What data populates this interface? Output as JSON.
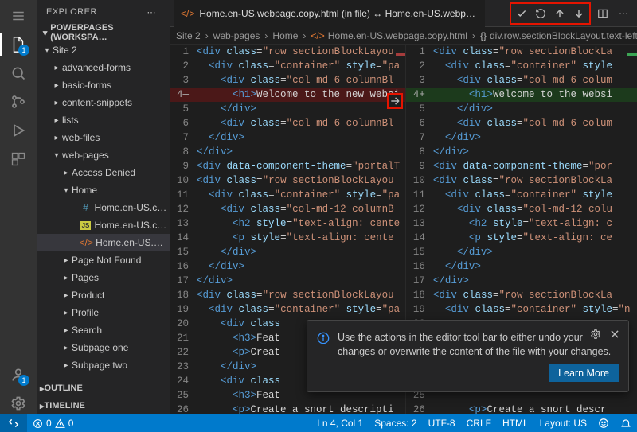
{
  "explorer": {
    "title": "EXPLORER",
    "workspace": "POWERPAGES (WORKSPA…",
    "outline": "OUTLINE",
    "timeline": "TIMELINE",
    "tree": [
      {
        "label": "Site 2",
        "depth": 0,
        "expanded": true,
        "type": "folder"
      },
      {
        "label": "advanced-forms",
        "depth": 1,
        "expanded": false,
        "type": "folder"
      },
      {
        "label": "basic-forms",
        "depth": 1,
        "expanded": false,
        "type": "folder"
      },
      {
        "label": "content-snippets",
        "depth": 1,
        "expanded": false,
        "type": "folder"
      },
      {
        "label": "lists",
        "depth": 1,
        "expanded": false,
        "type": "folder"
      },
      {
        "label": "web-files",
        "depth": 1,
        "expanded": false,
        "type": "folder"
      },
      {
        "label": "web-pages",
        "depth": 1,
        "expanded": true,
        "type": "folder"
      },
      {
        "label": "Access Denied",
        "depth": 2,
        "expanded": false,
        "type": "folder"
      },
      {
        "label": "Home",
        "depth": 2,
        "expanded": true,
        "type": "folder"
      },
      {
        "label": "Home.en-US.cust…",
        "depth": 3,
        "type": "file",
        "icon": "hash"
      },
      {
        "label": "Home.en-US.cust…",
        "depth": 3,
        "type": "file",
        "icon": "js"
      },
      {
        "label": "Home.en-US.web…",
        "depth": 3,
        "type": "file",
        "icon": "code",
        "selected": true
      },
      {
        "label": "Page Not Found",
        "depth": 2,
        "expanded": false,
        "type": "folder"
      },
      {
        "label": "Pages",
        "depth": 2,
        "expanded": false,
        "type": "folder"
      },
      {
        "label": "Product",
        "depth": 2,
        "expanded": false,
        "type": "folder"
      },
      {
        "label": "Profile",
        "depth": 2,
        "expanded": false,
        "type": "folder"
      },
      {
        "label": "Search",
        "depth": 2,
        "expanded": false,
        "type": "folder"
      },
      {
        "label": "Subpage one",
        "depth": 2,
        "expanded": false,
        "type": "folder"
      },
      {
        "label": "Subpage two",
        "depth": 2,
        "expanded": false,
        "type": "folder"
      },
      {
        "label": "web-templates",
        "depth": 1,
        "expanded": false,
        "type": "folder"
      }
    ]
  },
  "tab": {
    "label": "Home.en-US.webpage.copy.html (in file) ↔ Home.en-US.webpage.copy"
  },
  "breadcrumbs": [
    {
      "label": "Site 2"
    },
    {
      "label": "web-pages"
    },
    {
      "label": "Home"
    },
    {
      "label": "Home.en-US.webpage.copy.html",
      "icon": "code"
    },
    {
      "label": "div.row.sectionBlockLayout.text-left",
      "icon": "brackets"
    }
  ],
  "diff": {
    "left": [
      {
        "n": 1,
        "html": "<span class='tok-tag'>&lt;div</span> <span class='tok-attr'>class</span>=<span class='tok-str'>\"row sectionBlockLayou</span>"
      },
      {
        "n": 2,
        "html": "  <span class='tok-tag'>&lt;div</span> <span class='tok-attr'>class</span>=<span class='tok-str'>\"container\"</span> <span class='tok-attr'>style</span>=<span class='tok-str'>\"pa</span>"
      },
      {
        "n": 3,
        "html": "    <span class='tok-tag'>&lt;div</span> <span class='tok-attr'>class</span>=<span class='tok-str'>\"col-md-6 columnBl</span>"
      },
      {
        "n": "4—",
        "html": "      <span class='tok-tag'>&lt;h1&gt;</span><span class='tok-txt'>Welcome to the new websi</span>",
        "cls": "diff-del"
      },
      {
        "n": 5,
        "html": "    <span class='tok-tag'>&lt;/div&gt;</span>"
      },
      {
        "n": 6,
        "html": "    <span class='tok-tag'>&lt;div</span> <span class='tok-attr'>class</span>=<span class='tok-str'>\"col-md-6 columnBl</span>"
      },
      {
        "n": 7,
        "html": "  <span class='tok-tag'>&lt;/div&gt;</span>"
      },
      {
        "n": 8,
        "html": "<span class='tok-tag'>&lt;/div&gt;</span>"
      },
      {
        "n": 9,
        "html": "<span class='tok-tag'>&lt;div</span> <span class='tok-attr'>data-component-theme</span>=<span class='tok-str'>\"portalT</span>"
      },
      {
        "n": 10,
        "html": "<span class='tok-tag'>&lt;div</span> <span class='tok-attr'>class</span>=<span class='tok-str'>\"row sectionBlockLayou</span>"
      },
      {
        "n": 11,
        "html": "  <span class='tok-tag'>&lt;div</span> <span class='tok-attr'>class</span>=<span class='tok-str'>\"container\"</span> <span class='tok-attr'>style</span>=<span class='tok-str'>\"pa</span>"
      },
      {
        "n": 12,
        "html": "    <span class='tok-tag'>&lt;div</span> <span class='tok-attr'>class</span>=<span class='tok-str'>\"col-md-12 columnB</span>"
      },
      {
        "n": 13,
        "html": "      <span class='tok-tag'>&lt;h2</span> <span class='tok-attr'>style</span>=<span class='tok-str'>\"text-align: cente</span>"
      },
      {
        "n": 14,
        "html": "      <span class='tok-tag'>&lt;p</span> <span class='tok-attr'>style</span>=<span class='tok-str'>\"text-align: cente</span>"
      },
      {
        "n": 15,
        "html": "    <span class='tok-tag'>&lt;/div&gt;</span>"
      },
      {
        "n": 16,
        "html": "  <span class='tok-tag'>&lt;/div&gt;</span>"
      },
      {
        "n": 17,
        "html": "<span class='tok-tag'>&lt;/div&gt;</span>"
      },
      {
        "n": 18,
        "html": "<span class='tok-tag'>&lt;div</span> <span class='tok-attr'>class</span>=<span class='tok-str'>\"row sectionBlockLayou</span>"
      },
      {
        "n": 19,
        "html": "  <span class='tok-tag'>&lt;div</span> <span class='tok-attr'>class</span>=<span class='tok-str'>\"container\"</span> <span class='tok-attr'>style</span>=<span class='tok-str'>\"pa</span>"
      },
      {
        "n": 20,
        "html": "    <span class='tok-tag'>&lt;div</span> <span class='tok-attr'>class</span>"
      },
      {
        "n": 21,
        "html": "      <span class='tok-tag'>&lt;h3&gt;</span><span class='tok-txt'>Feat</span>"
      },
      {
        "n": 22,
        "html": "      <span class='tok-tag'>&lt;p&gt;</span><span class='tok-txt'>Creat</span>"
      },
      {
        "n": 23,
        "html": "    <span class='tok-tag'>&lt;/div&gt;</span>"
      },
      {
        "n": 24,
        "html": "    <span class='tok-tag'>&lt;div</span> <span class='tok-attr'>class</span>"
      },
      {
        "n": 25,
        "html": "      <span class='tok-tag'>&lt;h3&gt;</span><span class='tok-txt'>Feat</span>"
      },
      {
        "n": 26,
        "html": "      <span class='tok-tag'>&lt;p&gt;</span><span class='tok-txt'>Create a snort descripti</span>"
      }
    ],
    "right": [
      {
        "n": 1,
        "html": "<span class='tok-tag'>&lt;div</span> <span class='tok-attr'>class</span>=<span class='tok-str'>\"row sectionBlockLa</span>"
      },
      {
        "n": 2,
        "html": "  <span class='tok-tag'>&lt;div</span> <span class='tok-attr'>class</span>=<span class='tok-str'>\"container\"</span> <span class='tok-attr'>style</span>"
      },
      {
        "n": 3,
        "html": "    <span class='tok-tag'>&lt;div</span> <span class='tok-attr'>class</span>=<span class='tok-str'>\"col-md-6 colum</span>"
      },
      {
        "n": "4+",
        "html": "      <span class='tok-tag'>&lt;h1&gt;</span><span class='tok-txt'>Welcome to the websi</span>",
        "cls": "diff-add"
      },
      {
        "n": 5,
        "html": "    <span class='tok-tag'>&lt;/div&gt;</span>"
      },
      {
        "n": 6,
        "html": "    <span class='tok-tag'>&lt;div</span> <span class='tok-attr'>class</span>=<span class='tok-str'>\"col-md-6 colum</span>"
      },
      {
        "n": 7,
        "html": "  <span class='tok-tag'>&lt;/div&gt;</span>"
      },
      {
        "n": 8,
        "html": "<span class='tok-tag'>&lt;/div&gt;</span>"
      },
      {
        "n": 9,
        "html": "<span class='tok-tag'>&lt;div</span> <span class='tok-attr'>data-component-theme</span>=<span class='tok-str'>\"por</span>"
      },
      {
        "n": 10,
        "html": "<span class='tok-tag'>&lt;div</span> <span class='tok-attr'>class</span>=<span class='tok-str'>\"row sectionBlockLa</span>"
      },
      {
        "n": 11,
        "html": "  <span class='tok-tag'>&lt;div</span> <span class='tok-attr'>class</span>=<span class='tok-str'>\"container\"</span> <span class='tok-attr'>style</span>"
      },
      {
        "n": 12,
        "html": "    <span class='tok-tag'>&lt;div</span> <span class='tok-attr'>class</span>=<span class='tok-str'>\"col-md-12 colu</span>"
      },
      {
        "n": 13,
        "html": "      <span class='tok-tag'>&lt;h2</span> <span class='tok-attr'>style</span>=<span class='tok-str'>\"text-align: c</span>"
      },
      {
        "n": 14,
        "html": "      <span class='tok-tag'>&lt;p</span> <span class='tok-attr'>style</span>=<span class='tok-str'>\"text-align: ce</span>"
      },
      {
        "n": 15,
        "html": "    <span class='tok-tag'>&lt;/div&gt;</span>"
      },
      {
        "n": 16,
        "html": "  <span class='tok-tag'>&lt;/div&gt;</span>"
      },
      {
        "n": 17,
        "html": "<span class='tok-tag'>&lt;/div&gt;</span>"
      },
      {
        "n": 18,
        "html": "<span class='tok-tag'>&lt;div</span> <span class='tok-attr'>class</span>=<span class='tok-str'>\"row sectionBlockLa</span>"
      },
      {
        "n": 19,
        "html": "  <span class='tok-tag'>&lt;div</span> <span class='tok-attr'>class</span>=<span class='tok-str'>\"container\"</span> <span class='tok-attr'>style</span>=<span class='tok-str'>\"n</span>"
      },
      {
        "n": 20,
        "html": ""
      },
      {
        "n": 21,
        "html": ""
      },
      {
        "n": 22,
        "html": ""
      },
      {
        "n": 23,
        "html": ""
      },
      {
        "n": 24,
        "html": ""
      },
      {
        "n": 25,
        "html": ""
      },
      {
        "n": 26,
        "html": "      <span class='tok-tag'>&lt;p&gt;</span><span class='tok-txt'>Create a snort descr</span>"
      }
    ]
  },
  "toast": {
    "message": "Use the actions in the editor tool bar to either undo your changes or overwrite the content of the file with your changes.",
    "button": "Learn More"
  },
  "status": {
    "errors": "0",
    "warnings": "0",
    "ln": "Ln 4, Col 1",
    "spaces": "Spaces: 2",
    "encoding": "UTF-8",
    "eol": "CRLF",
    "lang": "HTML",
    "layout": "Layout: US"
  },
  "activity_badges": {
    "explorer": "1",
    "accounts": "1"
  }
}
